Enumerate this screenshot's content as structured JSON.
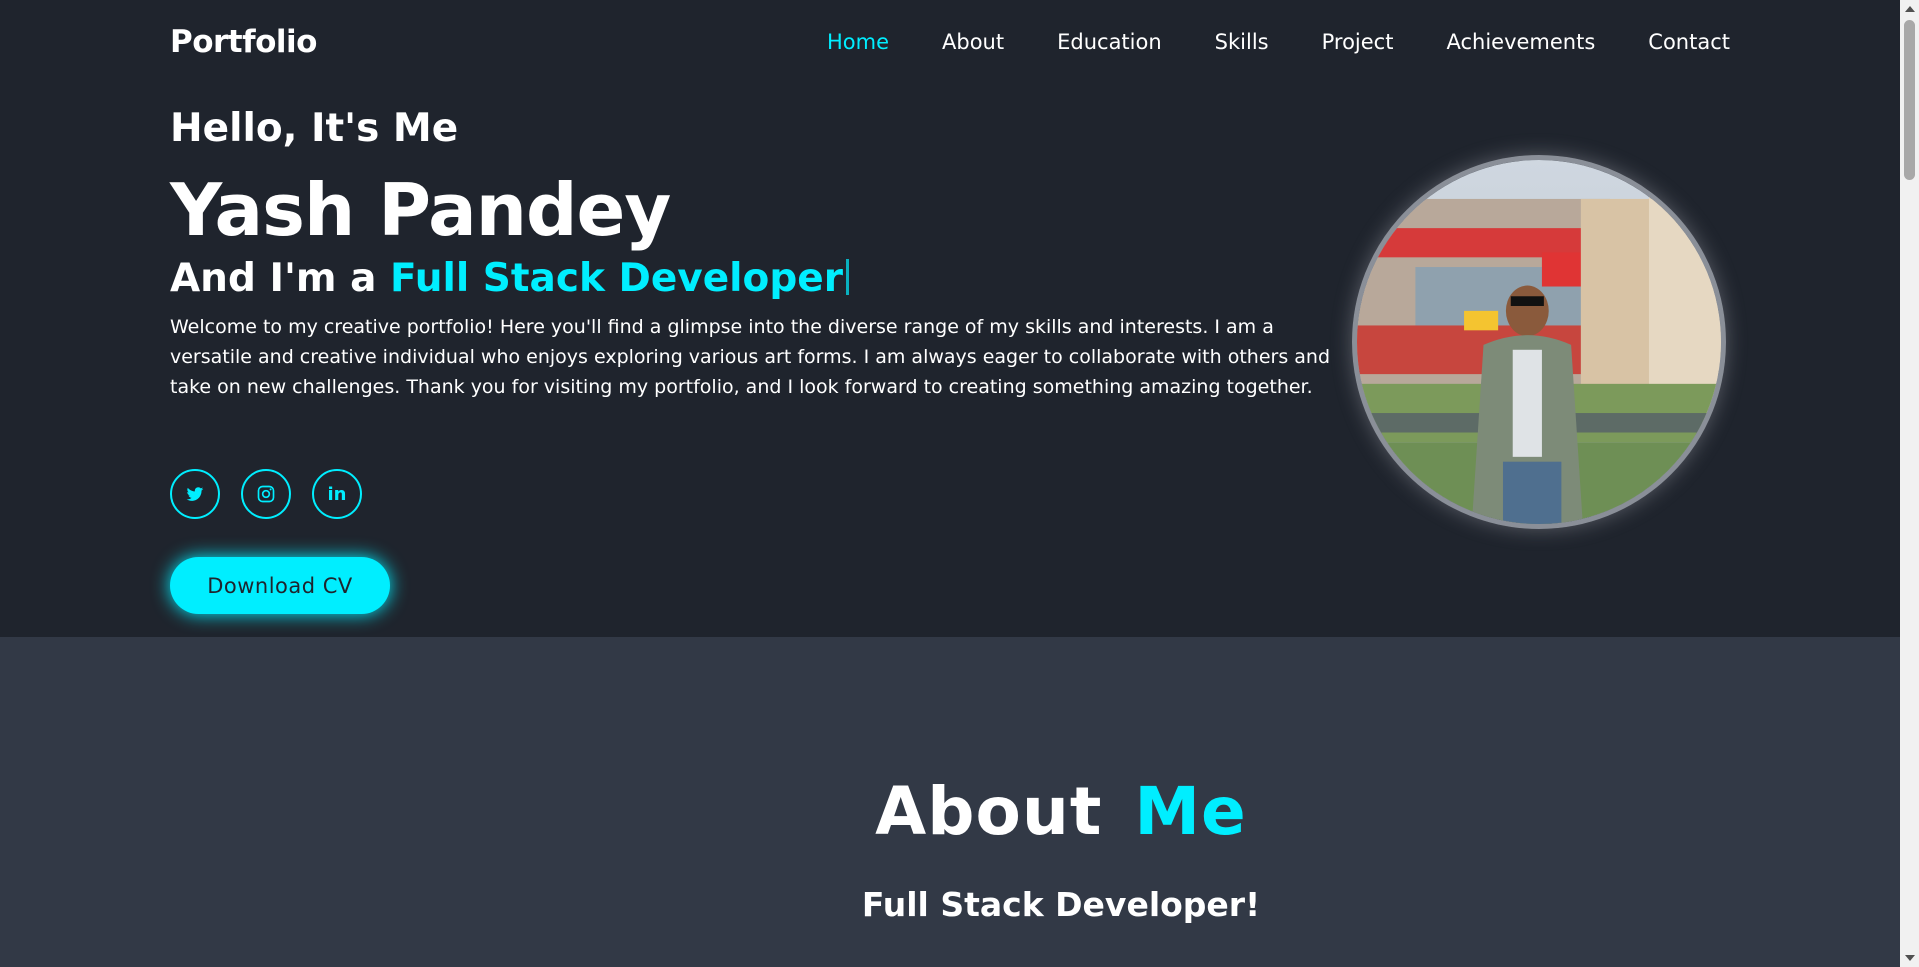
{
  "header": {
    "logo": "Portfolio",
    "nav": [
      {
        "label": "Home"
      },
      {
        "label": "About"
      },
      {
        "label": "Education"
      },
      {
        "label": "Skills"
      },
      {
        "label": "Project"
      },
      {
        "label": "Achievements"
      },
      {
        "label": "Contact"
      }
    ]
  },
  "hero": {
    "greeting": "Hello, It's Me",
    "name": "Yash Pandey",
    "role_prefix": "And I'm a",
    "role_title": "Full Stack Developer",
    "intro": "Welcome to my creative portfolio! Here you'll find a glimpse into the diverse range of my skills and interests. I am a versatile and creative individual who enjoys exploring various art forms. I am always eager to collaborate with others and take on new challenges. Thank you for visiting my portfolio, and I look forward to creating something amazing together.",
    "socials": [
      {
        "icon": "twitter-icon"
      },
      {
        "icon": "instagram-icon"
      },
      {
        "icon": "linkedin-icon",
        "text": "in"
      }
    ],
    "cv_button": "Download CV"
  },
  "about": {
    "title_main": "About",
    "title_accent": "Me",
    "subtitle": "Full Stack Developer!"
  },
  "colors": {
    "background": "#1f242d",
    "section_background": "#323946",
    "accent": "#00eeff",
    "text": "#ffffff"
  }
}
